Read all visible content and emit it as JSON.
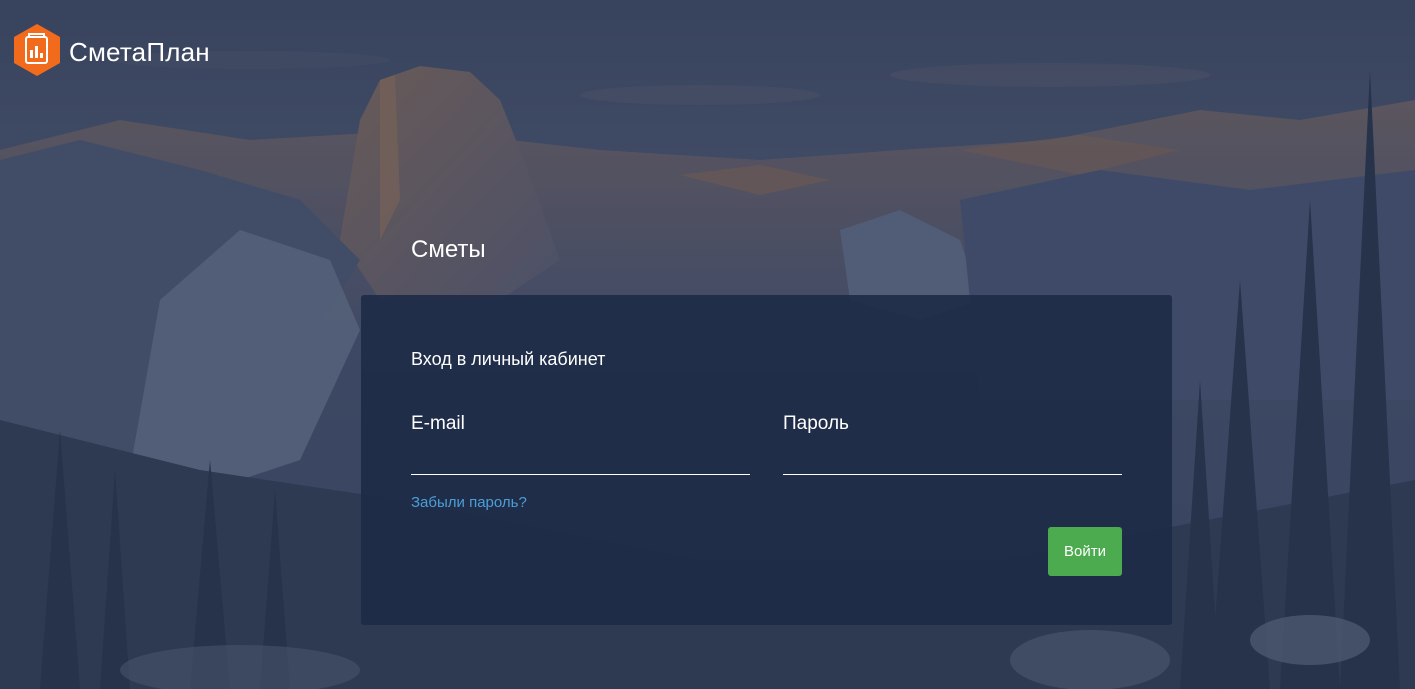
{
  "brand": {
    "name": "СметаПлан",
    "logo_icon": "calculator-chart-hex-icon",
    "logo_color": "#f26b1d"
  },
  "app_title": "Сметы",
  "login_form": {
    "heading": "Вход в личный кабинет",
    "email_label": "E-mail",
    "email_value": "",
    "password_label": "Пароль",
    "password_value": "",
    "forgot_link": "Забыли пароль?",
    "submit_label": "Войти"
  },
  "colors": {
    "panel_bg": "#1c2a46",
    "link": "#4a9fd8",
    "button": "#4caa4f"
  }
}
